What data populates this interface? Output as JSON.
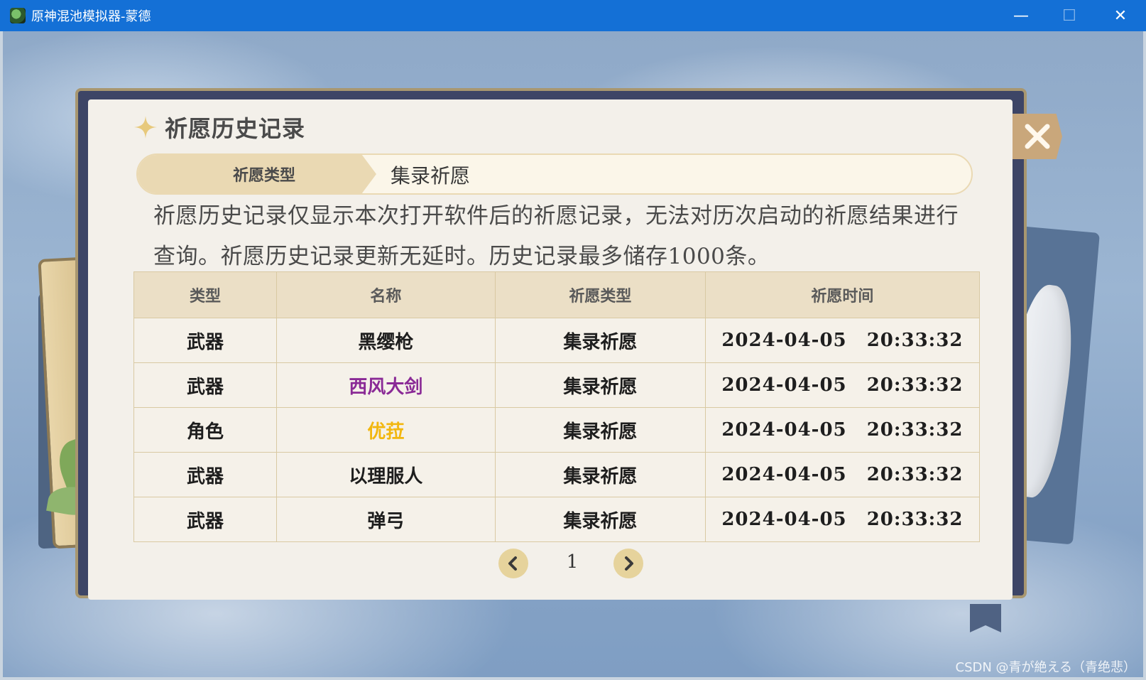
{
  "window": {
    "title": "原神混池模拟器-蒙德",
    "min": "—",
    "max": "☐",
    "close": "✕"
  },
  "panel": {
    "title": "祈愿历史记录",
    "wish_type_label": "祈愿类型",
    "wish_type_value": "集录祈愿",
    "notice": "祈愿历史记录仅显示本次打开软件后的祈愿记录，无法对历次启动的祈愿结果进行查询。祈愿历史记录更新无延时。历史记录最多储存1000条。"
  },
  "table": {
    "headers": [
      "类型",
      "名称",
      "祈愿类型",
      "祈愿时间"
    ],
    "rows": [
      {
        "type": "武器",
        "name": "黑缨枪",
        "wish": "集录祈愿",
        "time": "2024-04-05 20:33:32",
        "color": "#1e1e1e"
      },
      {
        "type": "武器",
        "name": "西风大剑",
        "wish": "集录祈愿",
        "time": "2024-04-05 20:33:32",
        "color": "#8a2a96"
      },
      {
        "type": "角色",
        "name": "优菈",
        "wish": "集录祈愿",
        "time": "2024-04-05 20:33:32",
        "color": "#f2b70f"
      },
      {
        "type": "武器",
        "name": "以理服人",
        "wish": "集录祈愿",
        "time": "2024-04-05 20:33:32",
        "color": "#1e1e1e"
      },
      {
        "type": "武器",
        "name": "弹弓",
        "wish": "集录祈愿",
        "time": "2024-04-05 20:33:32",
        "color": "#1e1e1e"
      }
    ]
  },
  "pager": {
    "page": "1"
  },
  "watermark": "CSDN @青が絶える（青绝悲）",
  "icons": {
    "star": "sparkle-star-icon",
    "close": "close-x-icon",
    "prev": "chevron-left-icon",
    "next": "chevron-right-icon"
  }
}
